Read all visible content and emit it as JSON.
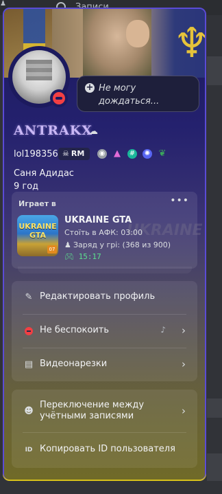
{
  "background": {
    "top_bar_text": "Записи"
  },
  "profile": {
    "display_name": "ANTRAKX",
    "username": "lol198356",
    "tag": "RM",
    "status_text": "Не могу дождаться...",
    "bio_line1": "Саня Адидас",
    "bio_line2": "9 год",
    "badges": [
      {
        "name": "speed-badge-icon",
        "glyph": "◉",
        "color": "#9aa0a6"
      },
      {
        "name": "triangle-badge-icon",
        "glyph": "▲",
        "color": "#e26bd6"
      },
      {
        "name": "hashtag-badge-icon",
        "glyph": "#",
        "color": "#19b69a"
      },
      {
        "name": "gear-badge-icon",
        "glyph": "✺",
        "color": "#5865f2"
      },
      {
        "name": "leaf-badge-icon",
        "glyph": "❦",
        "color": "#3ba55c"
      }
    ]
  },
  "activity": {
    "header": "Играет в",
    "game_title": "UKRAINE GTA",
    "line1": "Стоїть в АФК: 03:00",
    "line2": "Заряд у грі: (368 из 900)",
    "elapsed": "15:17",
    "art_title": "UKRAINE GTA"
  },
  "menu": {
    "edit_profile": "Редактировать профиль",
    "dnd": "Не беспокоить",
    "clips": "Видеонарезки",
    "switch_accounts": "Переключение между учётными записями",
    "copy_id": "Копировать ID пользователя"
  }
}
